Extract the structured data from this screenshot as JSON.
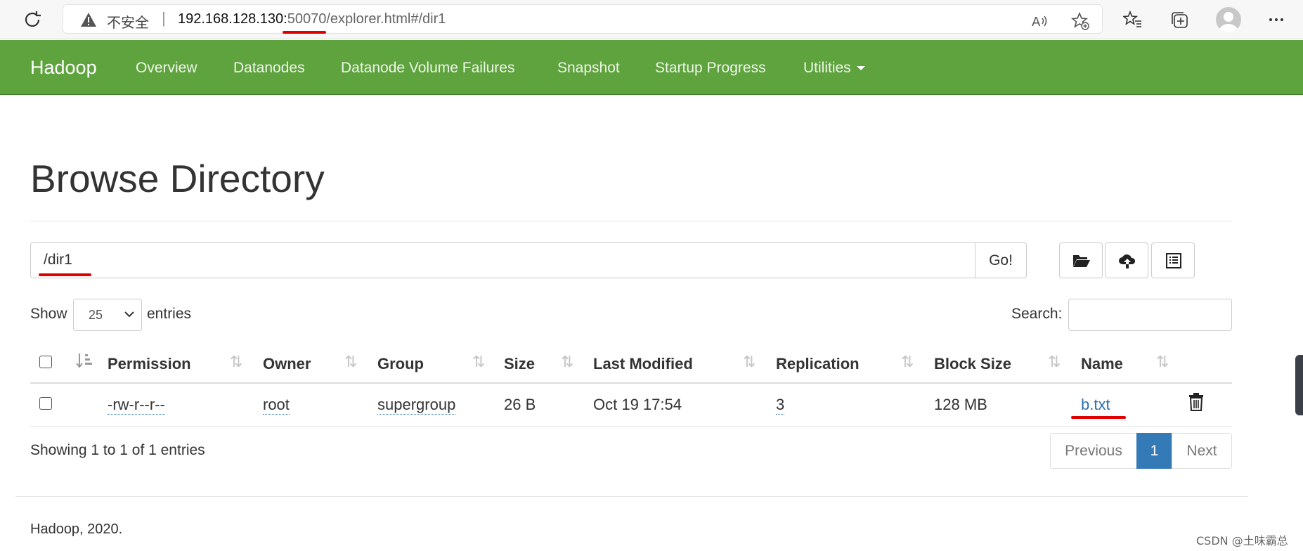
{
  "browser": {
    "security_label": "不安全",
    "url_host": "192.168.128.130:",
    "url_port": "50070",
    "url_path": "/explorer.html#/dir1"
  },
  "navbar": {
    "brand": "Hadoop",
    "items": [
      "Overview",
      "Datanodes",
      "Datanode Volume Failures",
      "Snapshot",
      "Startup Progress",
      "Utilities"
    ]
  },
  "page": {
    "title": "Browse Directory",
    "path_value": "/dir1",
    "go_label": "Go!",
    "show_label": "Show",
    "entries_value": "25",
    "entries_label": "entries",
    "search_label": "Search:"
  },
  "table": {
    "headers": [
      "Permission",
      "Owner",
      "Group",
      "Size",
      "Last Modified",
      "Replication",
      "Block Size",
      "Name"
    ],
    "rows": [
      {
        "permission": "-rw-r--r--",
        "owner": "root",
        "group": "supergroup",
        "size": "26 B",
        "last_modified": "Oct 19 17:54",
        "replication": "3",
        "block_size": "128 MB",
        "name": "b.txt"
      }
    ]
  },
  "pagination": {
    "info": "Showing 1 to 1 of 1 entries",
    "previous": "Previous",
    "current_page": "1",
    "next": "Next"
  },
  "footer": {
    "text": "Hadoop, 2020."
  },
  "watermark": "CSDN @土味霸总",
  "colors": {
    "navbar": "#5fa33e",
    "link": "#2f6fb0",
    "active_page": "#337ab7",
    "annotation_red": "#e00000"
  }
}
